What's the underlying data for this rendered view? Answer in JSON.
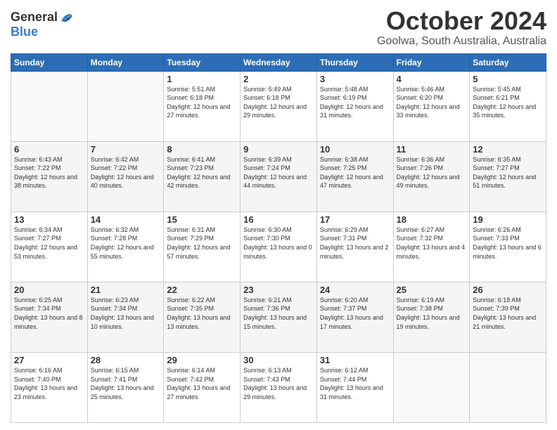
{
  "logo": {
    "general": "General",
    "blue": "Blue"
  },
  "header": {
    "month": "October 2024",
    "location": "Goolwa, South Australia, Australia"
  },
  "weekdays": [
    "Sunday",
    "Monday",
    "Tuesday",
    "Wednesday",
    "Thursday",
    "Friday",
    "Saturday"
  ],
  "weeks": [
    [
      {
        "day": "",
        "sunrise": "",
        "sunset": "",
        "daylight": ""
      },
      {
        "day": "",
        "sunrise": "",
        "sunset": "",
        "daylight": ""
      },
      {
        "day": "1",
        "sunrise": "Sunrise: 5:51 AM",
        "sunset": "Sunset: 6:18 PM",
        "daylight": "Daylight: 12 hours and 27 minutes."
      },
      {
        "day": "2",
        "sunrise": "Sunrise: 5:49 AM",
        "sunset": "Sunset: 6:18 PM",
        "daylight": "Daylight: 12 hours and 29 minutes."
      },
      {
        "day": "3",
        "sunrise": "Sunrise: 5:48 AM",
        "sunset": "Sunset: 6:19 PM",
        "daylight": "Daylight: 12 hours and 31 minutes."
      },
      {
        "day": "4",
        "sunrise": "Sunrise: 5:46 AM",
        "sunset": "Sunset: 6:20 PM",
        "daylight": "Daylight: 12 hours and 33 minutes."
      },
      {
        "day": "5",
        "sunrise": "Sunrise: 5:45 AM",
        "sunset": "Sunset: 6:21 PM",
        "daylight": "Daylight: 12 hours and 35 minutes."
      }
    ],
    [
      {
        "day": "6",
        "sunrise": "Sunrise: 6:43 AM",
        "sunset": "Sunset: 7:22 PM",
        "daylight": "Daylight: 12 hours and 38 minutes."
      },
      {
        "day": "7",
        "sunrise": "Sunrise: 6:42 AM",
        "sunset": "Sunset: 7:22 PM",
        "daylight": "Daylight: 12 hours and 40 minutes."
      },
      {
        "day": "8",
        "sunrise": "Sunrise: 6:41 AM",
        "sunset": "Sunset: 7:23 PM",
        "daylight": "Daylight: 12 hours and 42 minutes."
      },
      {
        "day": "9",
        "sunrise": "Sunrise: 6:39 AM",
        "sunset": "Sunset: 7:24 PM",
        "daylight": "Daylight: 12 hours and 44 minutes."
      },
      {
        "day": "10",
        "sunrise": "Sunrise: 6:38 AM",
        "sunset": "Sunset: 7:25 PM",
        "daylight": "Daylight: 12 hours and 47 minutes."
      },
      {
        "day": "11",
        "sunrise": "Sunrise: 6:36 AM",
        "sunset": "Sunset: 7:26 PM",
        "daylight": "Daylight: 12 hours and 49 minutes."
      },
      {
        "day": "12",
        "sunrise": "Sunrise: 6:35 AM",
        "sunset": "Sunset: 7:27 PM",
        "daylight": "Daylight: 12 hours and 51 minutes."
      }
    ],
    [
      {
        "day": "13",
        "sunrise": "Sunrise: 6:34 AM",
        "sunset": "Sunset: 7:27 PM",
        "daylight": "Daylight: 12 hours and 53 minutes."
      },
      {
        "day": "14",
        "sunrise": "Sunrise: 6:32 AM",
        "sunset": "Sunset: 7:28 PM",
        "daylight": "Daylight: 12 hours and 55 minutes."
      },
      {
        "day": "15",
        "sunrise": "Sunrise: 6:31 AM",
        "sunset": "Sunset: 7:29 PM",
        "daylight": "Daylight: 12 hours and 57 minutes."
      },
      {
        "day": "16",
        "sunrise": "Sunrise: 6:30 AM",
        "sunset": "Sunset: 7:30 PM",
        "daylight": "Daylight: 13 hours and 0 minutes."
      },
      {
        "day": "17",
        "sunrise": "Sunrise: 6:29 AM",
        "sunset": "Sunset: 7:31 PM",
        "daylight": "Daylight: 13 hours and 2 minutes."
      },
      {
        "day": "18",
        "sunrise": "Sunrise: 6:27 AM",
        "sunset": "Sunset: 7:32 PM",
        "daylight": "Daylight: 13 hours and 4 minutes."
      },
      {
        "day": "19",
        "sunrise": "Sunrise: 6:26 AM",
        "sunset": "Sunset: 7:33 PM",
        "daylight": "Daylight: 13 hours and 6 minutes."
      }
    ],
    [
      {
        "day": "20",
        "sunrise": "Sunrise: 6:25 AM",
        "sunset": "Sunset: 7:34 PM",
        "daylight": "Daylight: 13 hours and 8 minutes."
      },
      {
        "day": "21",
        "sunrise": "Sunrise: 6:23 AM",
        "sunset": "Sunset: 7:34 PM",
        "daylight": "Daylight: 13 hours and 10 minutes."
      },
      {
        "day": "22",
        "sunrise": "Sunrise: 6:22 AM",
        "sunset": "Sunset: 7:35 PM",
        "daylight": "Daylight: 13 hours and 13 minutes."
      },
      {
        "day": "23",
        "sunrise": "Sunrise: 6:21 AM",
        "sunset": "Sunset: 7:36 PM",
        "daylight": "Daylight: 13 hours and 15 minutes."
      },
      {
        "day": "24",
        "sunrise": "Sunrise: 6:20 AM",
        "sunset": "Sunset: 7:37 PM",
        "daylight": "Daylight: 13 hours and 17 minutes."
      },
      {
        "day": "25",
        "sunrise": "Sunrise: 6:19 AM",
        "sunset": "Sunset: 7:38 PM",
        "daylight": "Daylight: 13 hours and 19 minutes."
      },
      {
        "day": "26",
        "sunrise": "Sunrise: 6:18 AM",
        "sunset": "Sunset: 7:39 PM",
        "daylight": "Daylight: 13 hours and 21 minutes."
      }
    ],
    [
      {
        "day": "27",
        "sunrise": "Sunrise: 6:16 AM",
        "sunset": "Sunset: 7:40 PM",
        "daylight": "Daylight: 13 hours and 23 minutes."
      },
      {
        "day": "28",
        "sunrise": "Sunrise: 6:15 AM",
        "sunset": "Sunset: 7:41 PM",
        "daylight": "Daylight: 13 hours and 25 minutes."
      },
      {
        "day": "29",
        "sunrise": "Sunrise: 6:14 AM",
        "sunset": "Sunset: 7:42 PM",
        "daylight": "Daylight: 13 hours and 27 minutes."
      },
      {
        "day": "30",
        "sunrise": "Sunrise: 6:13 AM",
        "sunset": "Sunset: 7:43 PM",
        "daylight": "Daylight: 13 hours and 29 minutes."
      },
      {
        "day": "31",
        "sunrise": "Sunrise: 6:12 AM",
        "sunset": "Sunset: 7:44 PM",
        "daylight": "Daylight: 13 hours and 31 minutes."
      },
      {
        "day": "",
        "sunrise": "",
        "sunset": "",
        "daylight": ""
      },
      {
        "day": "",
        "sunrise": "",
        "sunset": "",
        "daylight": ""
      }
    ]
  ]
}
